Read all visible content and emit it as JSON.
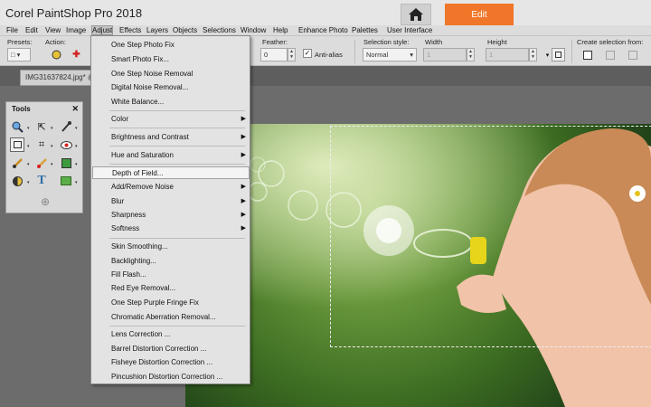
{
  "app_title": "Corel PaintShop Pro 2018",
  "top_tabs": {
    "edit": "Edit"
  },
  "menubar": [
    "File",
    "Edit",
    "View",
    "Image",
    "Adjust",
    "Effects",
    "Layers",
    "Objects",
    "Selections",
    "Window",
    "Help",
    "Enhance Photo",
    "Palettes",
    "User Interface"
  ],
  "toolbar": {
    "presets_label": "Presets:",
    "action_label": "Action:",
    "feather_label": "Feather:",
    "feather_value": "0",
    "antialias_label": "Anti-alias",
    "selection_style_label": "Selection style:",
    "selection_style_value": "Normal",
    "width_label": "Width",
    "width_value": "1",
    "height_label": "Height",
    "height_value": "1",
    "create_selection_label": "Create selection from:"
  },
  "document_tab": "IMG31637824.jpg* @",
  "tools_panel": {
    "title": "Tools"
  },
  "adjust_menu": [
    "One Step Photo Fix",
    "Smart Photo Fix...",
    "One Step Noise Removal",
    "Digital Noise Removal...",
    "White Balance...",
    "Color",
    "Brightness and Contrast",
    "Hue and Saturation",
    "Depth of Field...",
    "Add/Remove Noise",
    "Blur",
    "Sharpness",
    "Softness",
    "Skin Smoothing...",
    "Backlighting...",
    "Fill Flash...",
    "Red Eye Removal...",
    "One Step Purple Fringe Fix",
    "Chromatic Aberration Removal...",
    "Lens Correction ...",
    "Barrel Distortion Correction ...",
    "Fisheye Distortion Correction ...",
    "Pincushion Distortion Correction ..."
  ],
  "colors": {
    "accent": "#f0772a",
    "menu_bg": "#e3e3e3",
    "chrome": "#dcdcdc",
    "workspace": "#6c6c6c"
  },
  "icons": [
    "home-icon",
    "close-icon",
    "submenu-arrow-icon"
  ]
}
